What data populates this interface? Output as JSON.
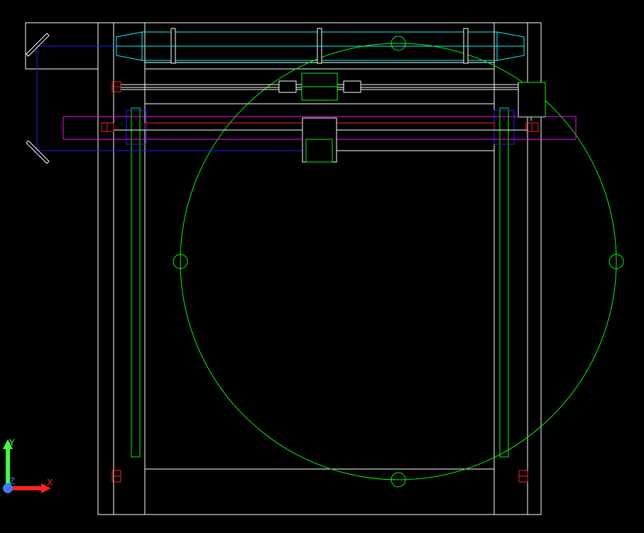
{
  "viewport": {
    "background": "#000000"
  },
  "ucs_icon": {
    "y_label": "Y",
    "x_label": "X",
    "z_label": "Z",
    "x_color": "#ff2020",
    "y_color": "#40ff40",
    "z_color": "#3a7bff"
  },
  "layers": {
    "frame": "#ffffff",
    "laser_tube": "#00ffff",
    "beam_path": "#2020ff",
    "gantry": "#ff00ff",
    "limit_switches": "#ff2020",
    "components": "#00ff00",
    "mirrors": "#ffffff"
  }
}
